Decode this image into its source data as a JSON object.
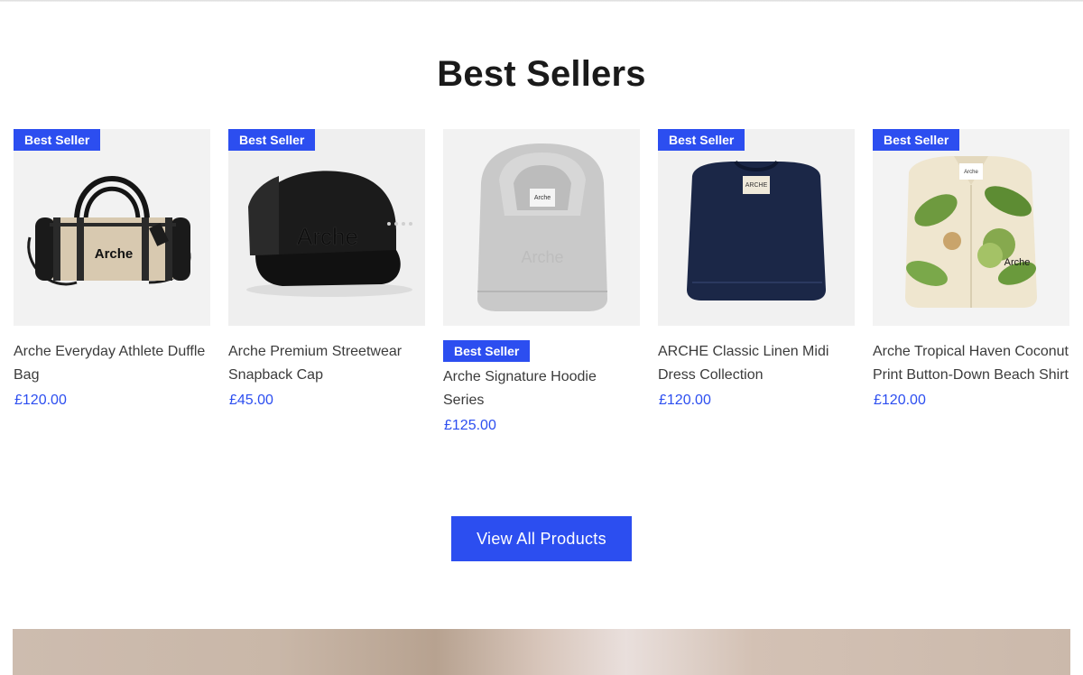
{
  "section": {
    "title": "Best Sellers"
  },
  "products": [
    {
      "badge": "Best Seller",
      "name": "Arche Everyday Athlete Duffle Bag",
      "price": "£120.00",
      "image": "duffle-bag",
      "logo": "Arche"
    },
    {
      "badge": "Best Seller",
      "name": "Arche Premium Streetwear Snapback Cap",
      "price": "£45.00",
      "image": "snapback-cap",
      "logo": "Arche"
    },
    {
      "badge": "Best Seller",
      "name": "Arche Signature Hoodie Series",
      "price": "£125.00",
      "image": "hoodie",
      "logo": "Arche"
    },
    {
      "badge": "Best Seller",
      "name": "ARCHE Classic Linen Midi Dress Collection",
      "price": "£120.00",
      "image": "navy-tee",
      "logo": "ARCHE"
    },
    {
      "badge": "Best Seller",
      "name": "Arche Tropical Haven Coconut Print Button-Down Beach Shirt",
      "price": "£120.00",
      "image": "tropical-shirt",
      "logo": "Arche"
    }
  ],
  "cta": {
    "label": "View All Products"
  },
  "colors": {
    "accent": "#2c4ef0",
    "text": "#3b3b3b",
    "title": "#1a1a1a"
  }
}
